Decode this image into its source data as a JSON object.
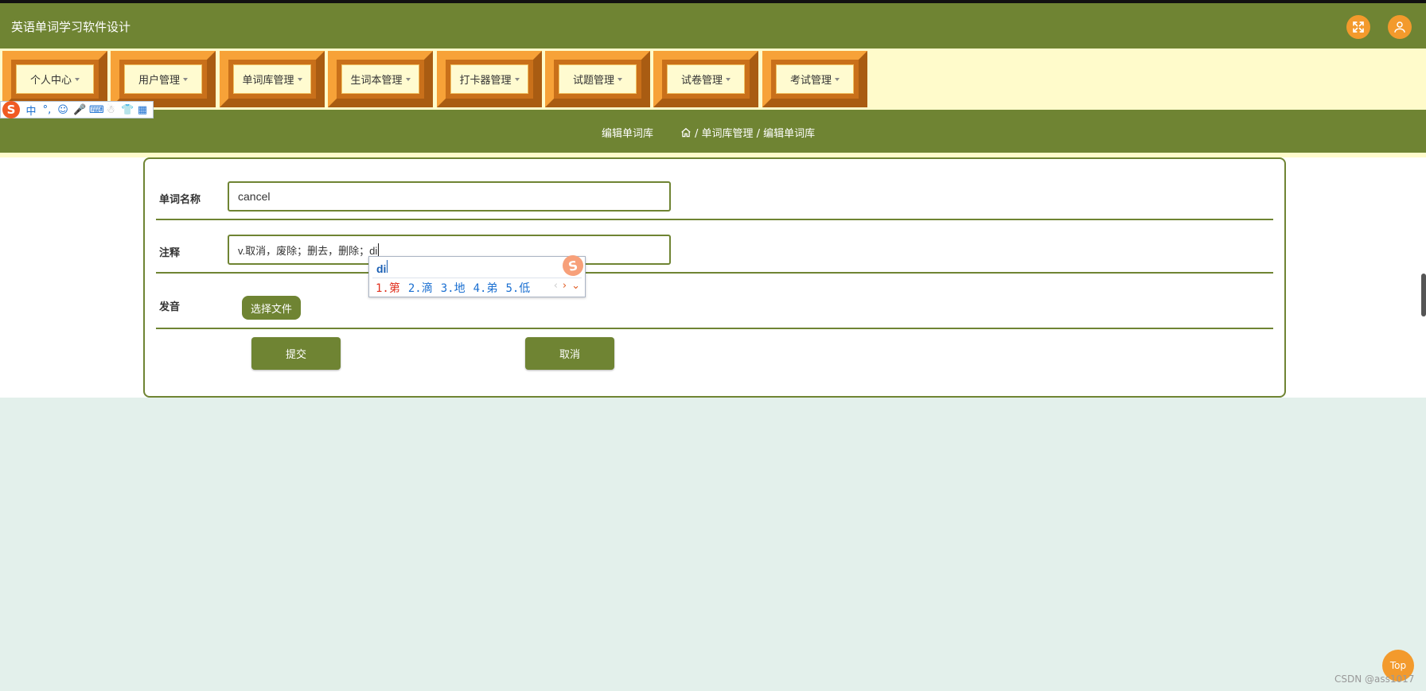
{
  "app": {
    "title": "英语单词学习软件设计"
  },
  "header": {
    "fullscreen_icon": "fullscreen-icon",
    "user_icon": "user-icon"
  },
  "nav": {
    "items": [
      {
        "label": "个人中心"
      },
      {
        "label": "用户管理"
      },
      {
        "label": "单词库管理"
      },
      {
        "label": "生词本管理"
      },
      {
        "label": "打卡器管理"
      },
      {
        "label": "试题管理"
      },
      {
        "label": "试卷管理"
      },
      {
        "label": "考试管理"
      }
    ]
  },
  "ime_toolbar": {
    "logo": "S",
    "mode": "中",
    "punct": "°,"
  },
  "breadcrumb": {
    "page_title": "编辑单词库",
    "path": "/ 单词库管理 / 编辑单词库"
  },
  "form": {
    "word_label": "单词名称",
    "word_value": "cancel",
    "note_label": "注释",
    "note_value": "v.取消，废除；删去，删除；di",
    "audio_label": "发音",
    "file_button": "选择文件",
    "submit_button": "提交",
    "cancel_button": "取消"
  },
  "ime_popup": {
    "composition": "di",
    "candidates": [
      "1.第",
      "2.滴",
      "3.地",
      "4.弟",
      "5.低"
    ]
  },
  "top_button": "Top",
  "watermark": "CSDN @ass1017",
  "colors": {
    "primary": "#6f8433",
    "accent": "#f39a2c",
    "nav_bg": "#fffbcb",
    "page_bg": "#e3f0eb"
  }
}
